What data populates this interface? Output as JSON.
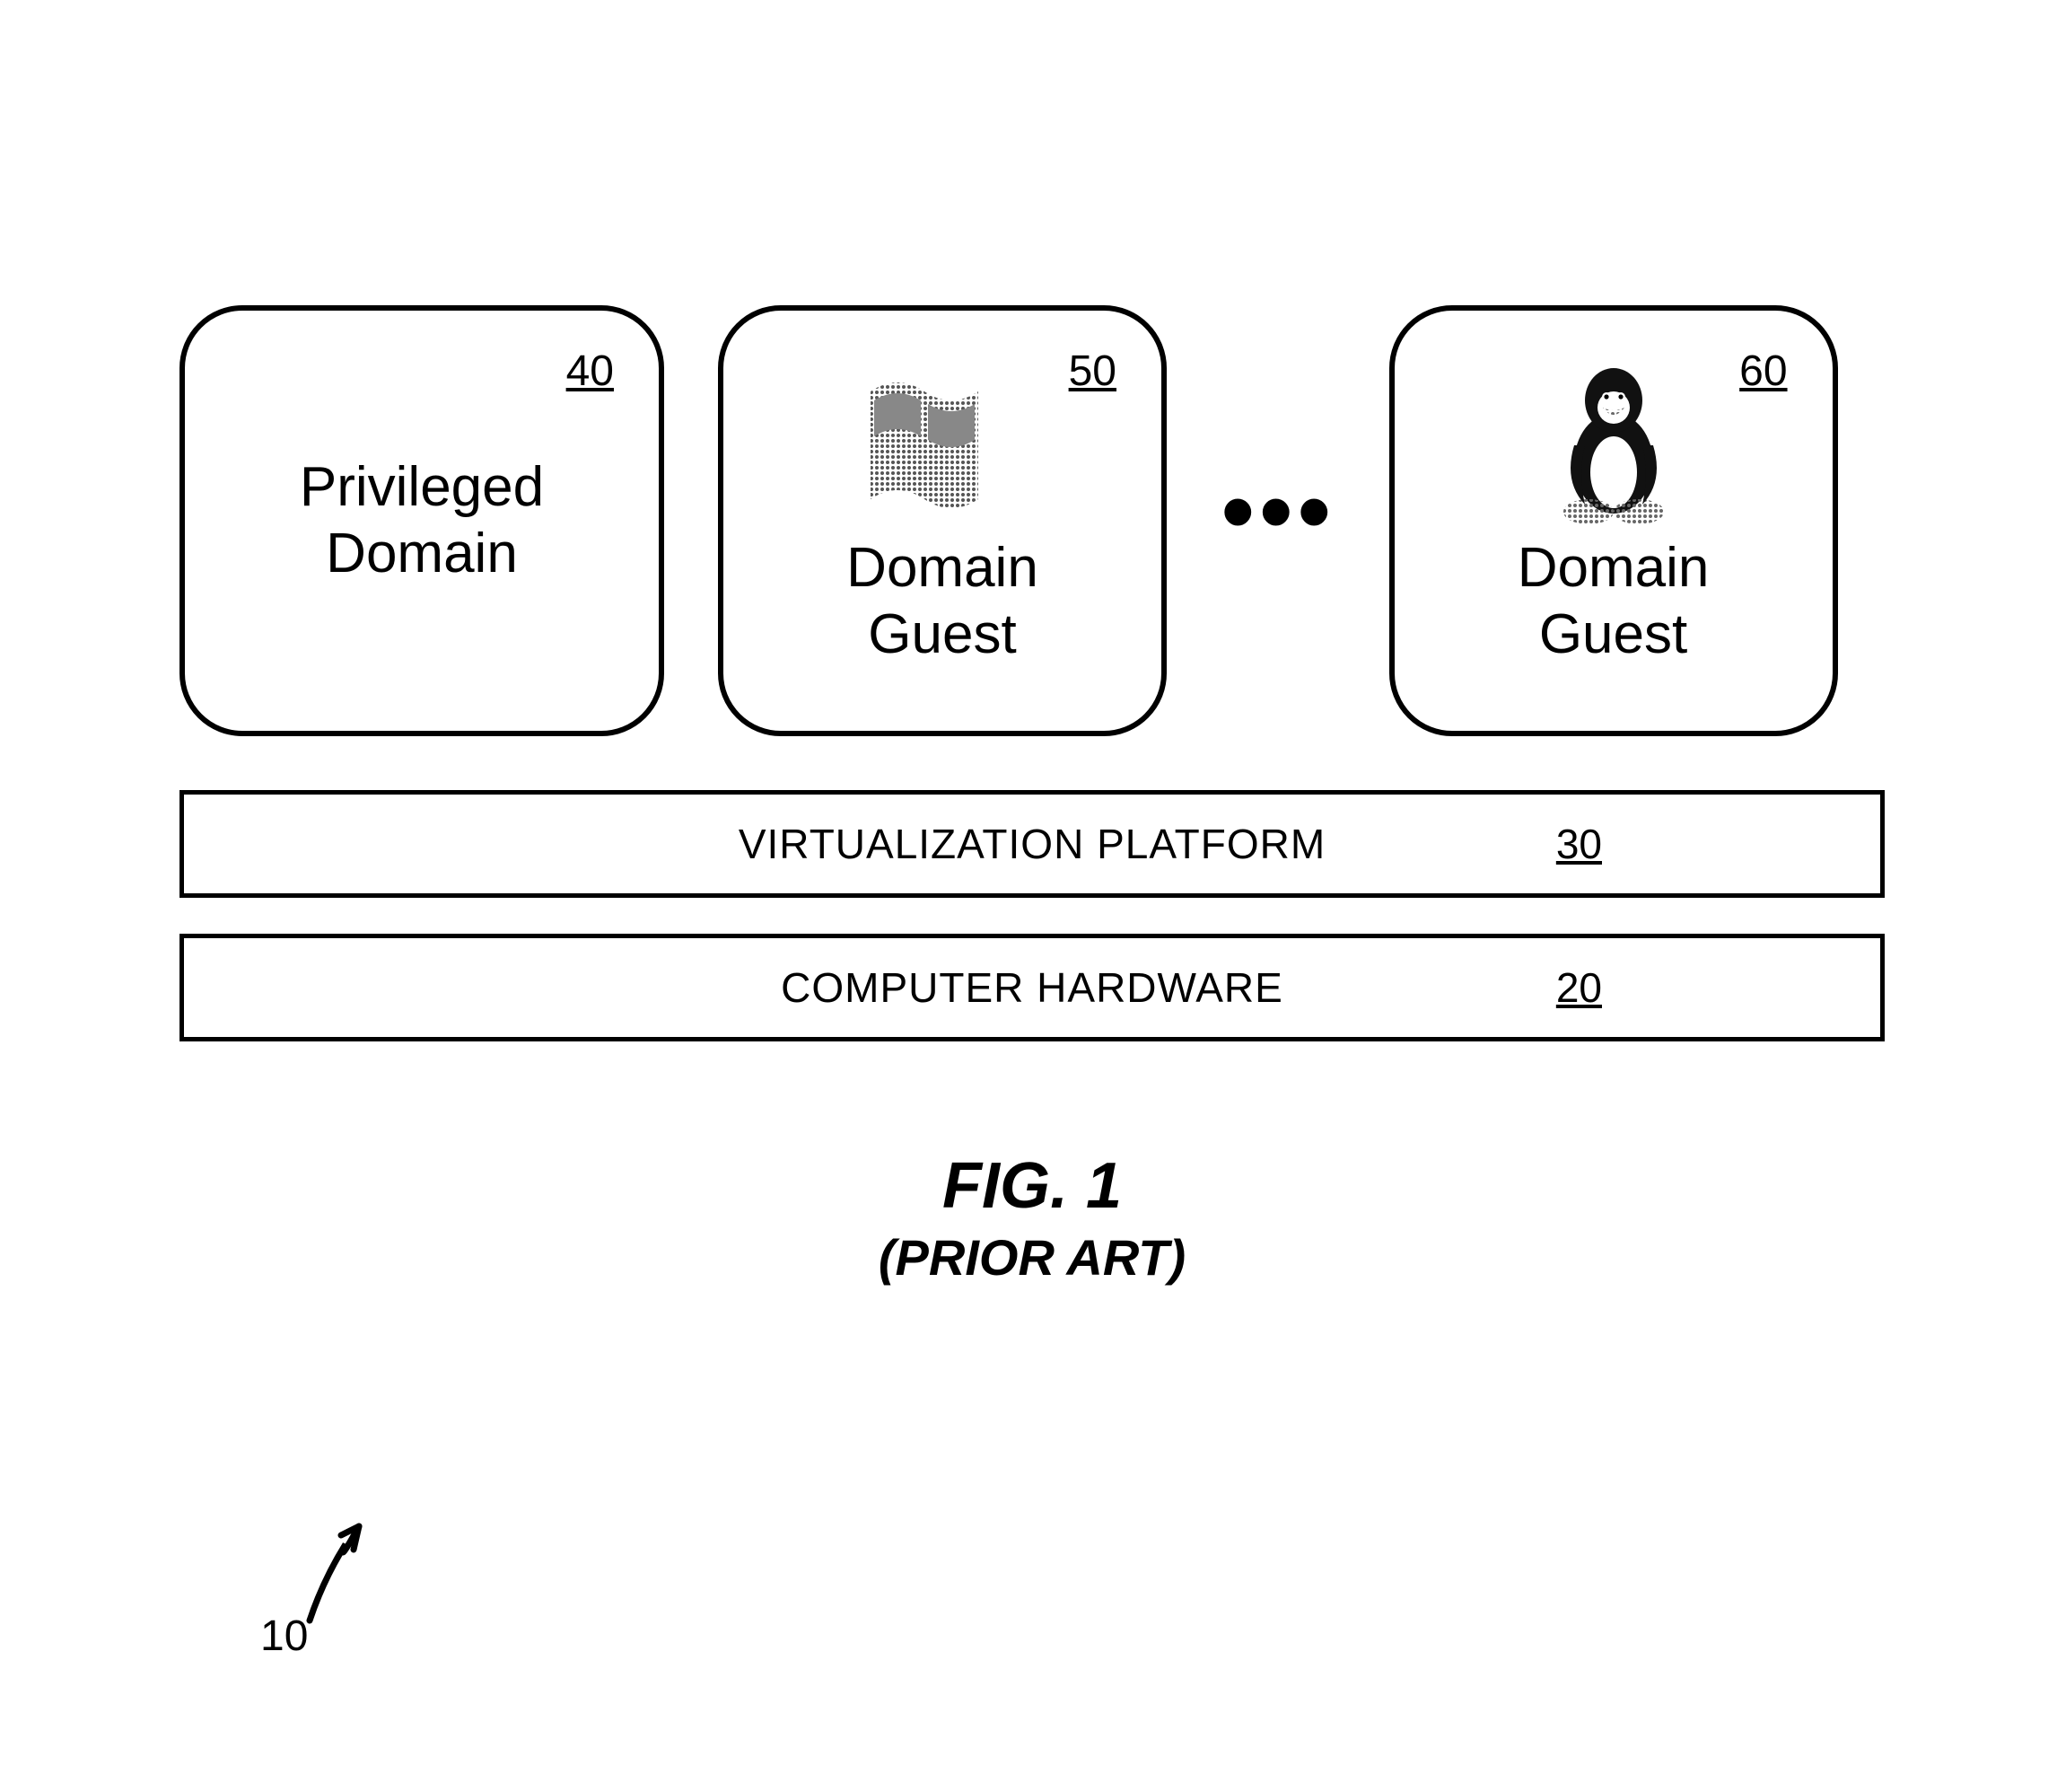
{
  "tiles": {
    "privileged": {
      "label_line1": "Privileged",
      "label_line2": "Domain",
      "ref": "40"
    },
    "guest1": {
      "label_line1": "Domain",
      "label_line2": "Guest",
      "ref": "50",
      "icon": "windows-flag-icon"
    },
    "guest2": {
      "label_line1": "Domain",
      "label_line2": "Guest",
      "ref": "60",
      "icon": "tux-penguin-icon"
    }
  },
  "ellipsis": "•••",
  "bars": {
    "virt": {
      "label": "VIRTUALIZATION PLATFORM",
      "ref": "30"
    },
    "hw": {
      "label": "COMPUTER HARDWARE",
      "ref": "20"
    }
  },
  "caption": {
    "line1": "FIG. 1",
    "line2": "(PRIOR ART)"
  },
  "diagram_ref": "10"
}
